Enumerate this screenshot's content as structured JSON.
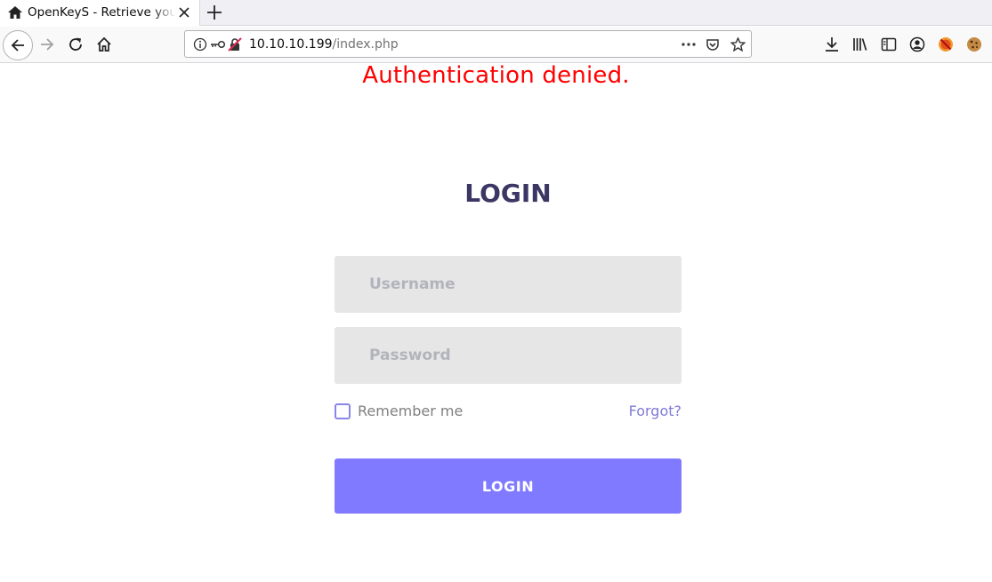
{
  "browser": {
    "tab_title": "OpenKeyS - Retrieve your OpenSSH Keys",
    "url_host": "10.10.10.199",
    "url_path": "/index.php"
  },
  "page": {
    "alert": "Authentication denied.",
    "heading": "LOGIN",
    "username_placeholder": "Username",
    "password_placeholder": "Password",
    "remember_label": "Remember me",
    "forgot_label": "Forgot?",
    "submit_label": "LOGIN"
  },
  "colors": {
    "alert": "#ff0000",
    "heading": "#3b3663",
    "accent": "#7f7aff",
    "field_bg": "#e6e6e6"
  }
}
